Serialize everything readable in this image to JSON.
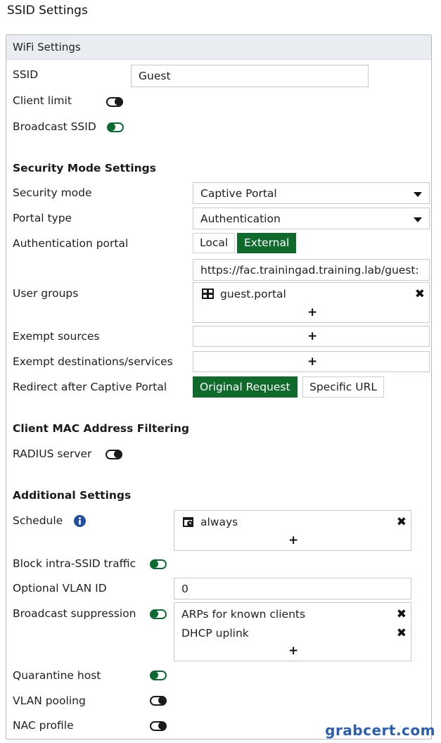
{
  "page_title": "SSID Settings",
  "wifi": {
    "header": "WiFi Settings",
    "ssid_label": "SSID",
    "ssid_value": "Guest",
    "client_limit_label": "Client limit",
    "client_limit_on": false,
    "broadcast_ssid_label": "Broadcast SSID",
    "broadcast_ssid_on": true
  },
  "security": {
    "section_title": "Security Mode Settings",
    "security_mode_label": "Security mode",
    "security_mode_value": "Captive Portal",
    "portal_type_label": "Portal type",
    "portal_type_value": "Authentication",
    "auth_portal_label": "Authentication portal",
    "auth_portal_options": [
      "Local",
      "External"
    ],
    "auth_portal_selected": "External",
    "portal_url": "https://fac.trainingad.training.lab/guest:",
    "user_groups_label": "User groups",
    "user_groups": [
      "guest.portal"
    ],
    "exempt_sources_label": "Exempt sources",
    "exempt_dest_label": "Exempt destinations/services",
    "redirect_label": "Redirect after Captive Portal",
    "redirect_options": [
      "Original Request",
      "Specific URL"
    ],
    "redirect_selected": "Original Request"
  },
  "mac_filtering": {
    "section_title": "Client MAC Address Filtering",
    "radius_label": "RADIUS server",
    "radius_on": false
  },
  "additional": {
    "section_title": "Additional Settings",
    "schedule_label": "Schedule",
    "schedule_items": [
      "always"
    ],
    "block_intra_label": "Block intra-SSID traffic",
    "block_intra_on": true,
    "vlan_id_label": "Optional VLAN ID",
    "vlan_id_value": "0",
    "broadcast_suppression_label": "Broadcast suppression",
    "broadcast_suppression_on": true,
    "broadcast_suppression_items": [
      "ARPs for known clients",
      "DHCP uplink"
    ],
    "quarantine_label": "Quarantine host",
    "quarantine_on": true,
    "vlan_pooling_label": "VLAN pooling",
    "vlan_pooling_on": false,
    "nac_profile_label": "NAC profile",
    "nac_profile_on": false
  },
  "add_symbol": "+",
  "remove_symbol": "✖",
  "watermark": "grabcert.com",
  "colors": {
    "accent_green": "#0f6a2c",
    "header_bg": "#e9edf1",
    "info_blue": "#1f4fa0",
    "watermark_blue": "#2b5fb3"
  }
}
